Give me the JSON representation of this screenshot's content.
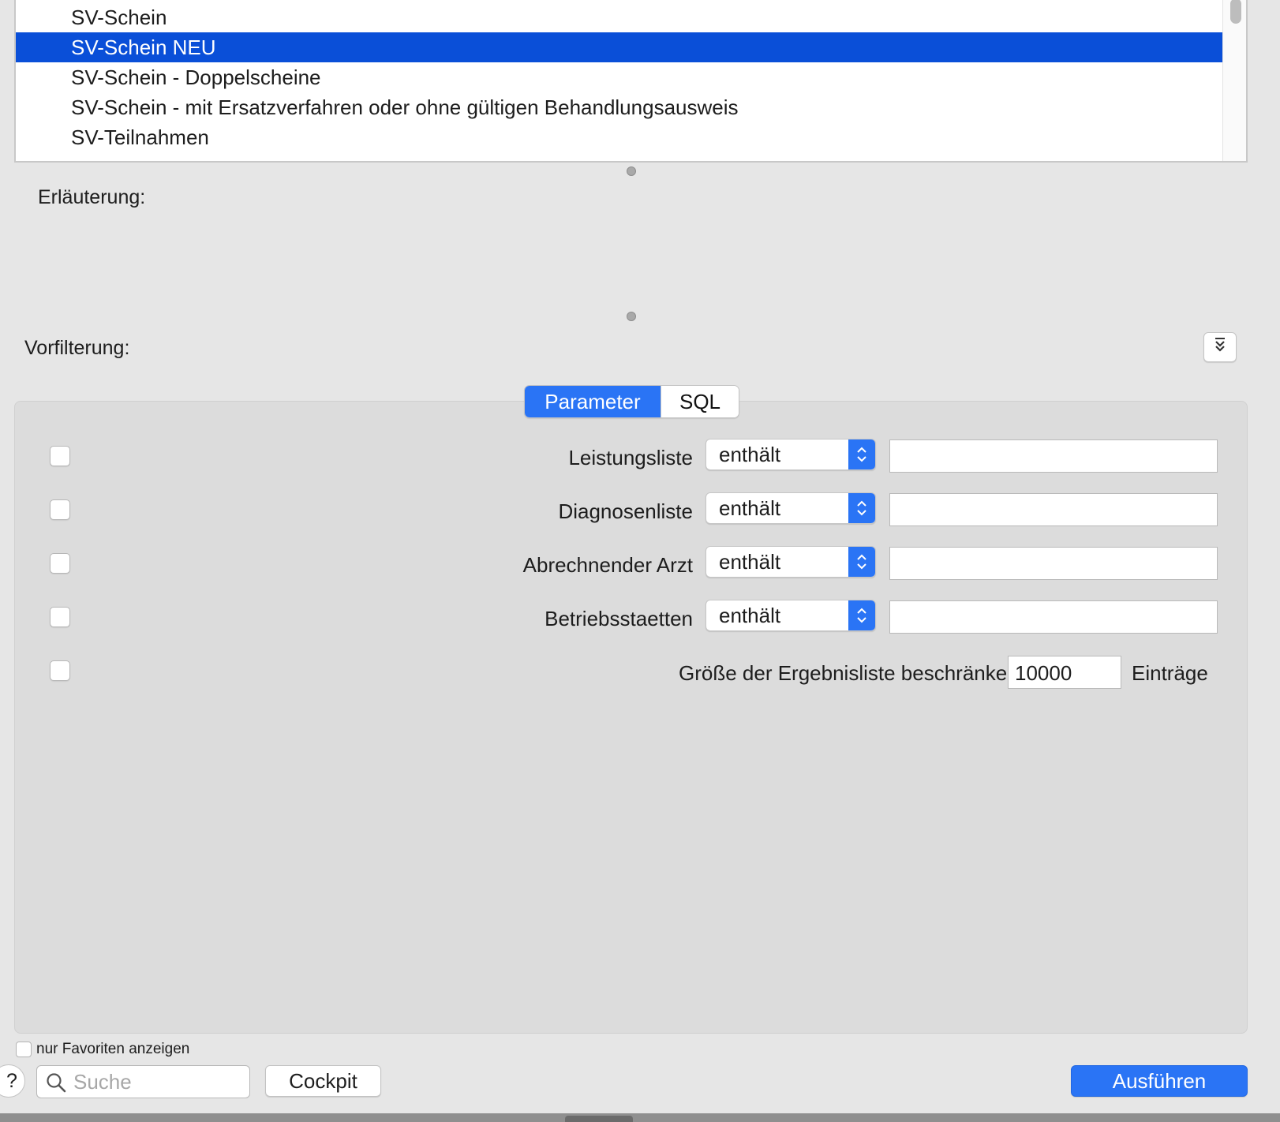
{
  "list": {
    "items": [
      {
        "label": "SV-Schein"
      },
      {
        "label": "SV-Schein NEU",
        "selected": true
      },
      {
        "label": "SV-Schein - Doppelscheine"
      },
      {
        "label": "SV-Schein - mit Ersatzverfahren oder ohne gültigen Behandlungsausweis"
      },
      {
        "label": "SV-Teilnahmen"
      }
    ]
  },
  "explanation": {
    "label": "Erläuterung:"
  },
  "prefilter": {
    "label": "Vorfilterung:",
    "toggle_icon": "double-chevron-down-icon"
  },
  "tabs": [
    {
      "label": "Parameter",
      "active": true
    },
    {
      "label": "SQL",
      "active": false
    }
  ],
  "parameters": [
    {
      "label": "Leistungsliste",
      "operator": "enthält",
      "value": "",
      "checked": false
    },
    {
      "label": "Diagnosenliste",
      "operator": "enthält",
      "value": "",
      "checked": false
    },
    {
      "label": "Abrechnender Arzt",
      "operator": "enthält",
      "value": "",
      "checked": false
    },
    {
      "label": "Betriebsstaetten",
      "operator": "enthält",
      "value": "",
      "checked": false
    }
  ],
  "limit": {
    "label": "Größe der Ergebnisliste beschränken auf",
    "value": "10000",
    "unit": "Einträge",
    "checked": false
  },
  "favorites": {
    "label": "nur Favoriten anzeigen",
    "checked": false
  },
  "search": {
    "placeholder": "Suche",
    "icon": "search-icon"
  },
  "buttons": {
    "cockpit": "Cockpit",
    "execute": "Ausführen",
    "help": "?"
  },
  "colors": {
    "accent": "#2a74f5",
    "selection": "#0a4fd8",
    "background": "#e6e6e6",
    "panel": "#dcdcdc"
  }
}
